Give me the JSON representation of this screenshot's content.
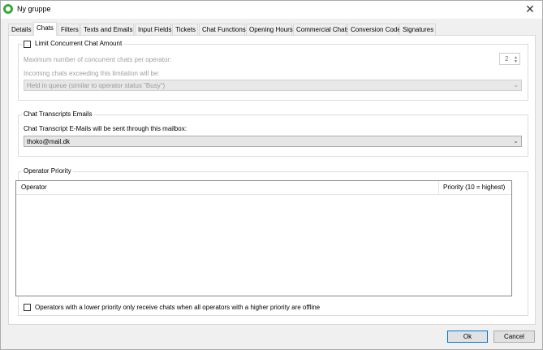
{
  "window": {
    "title": "Ny gruppe",
    "close_glyph": "✕"
  },
  "tabs": [
    {
      "label": "Details"
    },
    {
      "label": "Chats"
    },
    {
      "label": "Filters"
    },
    {
      "label": "Texts and Emails"
    },
    {
      "label": "Input Fields"
    },
    {
      "label": "Tickets"
    },
    {
      "label": "Chat Functions"
    },
    {
      "label": "Opening Hours"
    },
    {
      "label": "Commercial Chats"
    },
    {
      "label": "Conversion Code"
    },
    {
      "label": "Signatures"
    }
  ],
  "active_tab": "Chats",
  "limit": {
    "checkbox_label": "Limit Concurrent Chat Amount",
    "checked": false,
    "max_label": "Maximum number of concurrent chats per operator:",
    "max_value": "2",
    "exceed_label": "Incoming chats exceeding this limitation will be:",
    "exceed_value": "Held in queue (similar to operator status \"Busy\")"
  },
  "transcripts": {
    "title": "Chat Transcripts Emails",
    "label": "Chat Transcript E-Mails will be sent through this mailbox:",
    "mailbox": "thoko@mail.dk"
  },
  "priority": {
    "title": "Operator Priority",
    "columns": [
      "Operator",
      "Priority (10 = highest)"
    ],
    "rows": [],
    "checkbox_label": "Operators with a lower priority only receive chats when all operators with a higher priority are offline",
    "checked": false
  },
  "buttons": {
    "ok": "Ok",
    "cancel": "Cancel"
  },
  "icons": {
    "spin_up": "▲",
    "spin_down": "▼",
    "dropdown": "⌄"
  }
}
